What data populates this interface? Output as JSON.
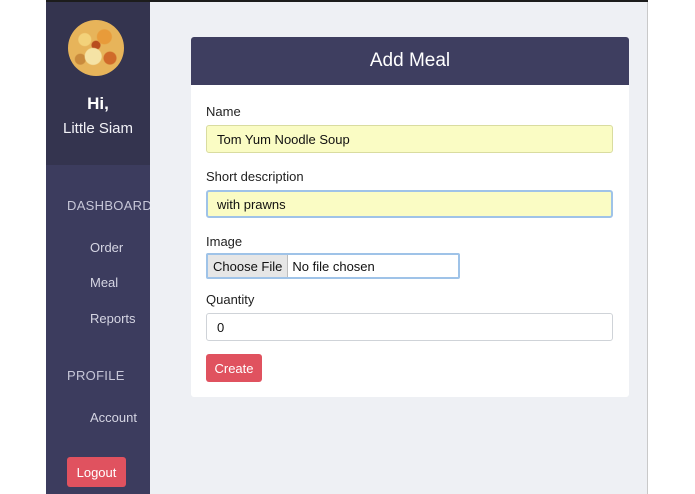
{
  "sidebar": {
    "greeting": "Hi,",
    "user_name": "Little Siam",
    "sections": [
      {
        "title": "DASHBOARD",
        "items": [
          "Order",
          "Meal",
          "Reports"
        ]
      },
      {
        "title": "PROFILE",
        "items": [
          "Account"
        ]
      }
    ],
    "logout_label": "Logout"
  },
  "form": {
    "title": "Add Meal",
    "name_label": "Name",
    "name_value": "Tom Yum Noodle Soup",
    "description_label": "Short description",
    "description_value": "with prawns",
    "image_label": "Image",
    "choose_file_label": "Choose File",
    "no_file_text": "No file chosen",
    "quantity_label": "Quantity",
    "quantity_value": "0",
    "create_label": "Create"
  },
  "colors": {
    "sidebar": "#3c3c5e",
    "header": "#3e3e60",
    "accent_button": "#e0525f",
    "autofill": "#fafcc4"
  }
}
